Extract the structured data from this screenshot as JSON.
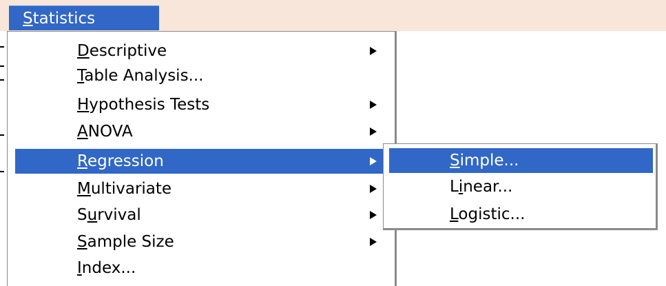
{
  "menubar": {
    "title": "Statistics",
    "title_mnemonic": "S"
  },
  "main_menu": {
    "items": [
      {
        "label": "Descriptive",
        "mnemonic": "D",
        "has_submenu": true,
        "selected": false
      },
      {
        "label": "Table Analysis...",
        "mnemonic": "T",
        "has_submenu": false,
        "selected": false
      },
      {
        "label": "Hypothesis Tests",
        "mnemonic": "H",
        "has_submenu": true,
        "selected": false
      },
      {
        "label": "ANOVA",
        "mnemonic": "A",
        "has_submenu": true,
        "selected": false
      },
      {
        "label": "Regression",
        "mnemonic": "R",
        "has_submenu": true,
        "selected": true
      },
      {
        "label": "Multivariate",
        "mnemonic": "M",
        "has_submenu": true,
        "selected": false
      },
      {
        "label": "Survival",
        "mnemonic": "u",
        "has_submenu": true,
        "selected": false
      },
      {
        "label": "Sample Size",
        "mnemonic": "S",
        "has_submenu": true,
        "selected": false
      },
      {
        "label": "Index...",
        "mnemonic": "I",
        "has_submenu": false,
        "selected": false
      }
    ]
  },
  "submenu": {
    "parent": "Regression",
    "items": [
      {
        "label": "Simple...",
        "mnemonic": "S",
        "selected": true
      },
      {
        "label": "Linear...",
        "mnemonic": "i",
        "selected": false
      },
      {
        "label": "Logistic...",
        "mnemonic": "L",
        "selected": false
      }
    ]
  },
  "colors": {
    "highlight": "#3167c6",
    "menubar_bg": "#f8e6db",
    "menu_bg": "#ffffff",
    "border": "#8a8a8a"
  },
  "icons": {
    "submenu_arrow": "triangle-right-icon"
  }
}
